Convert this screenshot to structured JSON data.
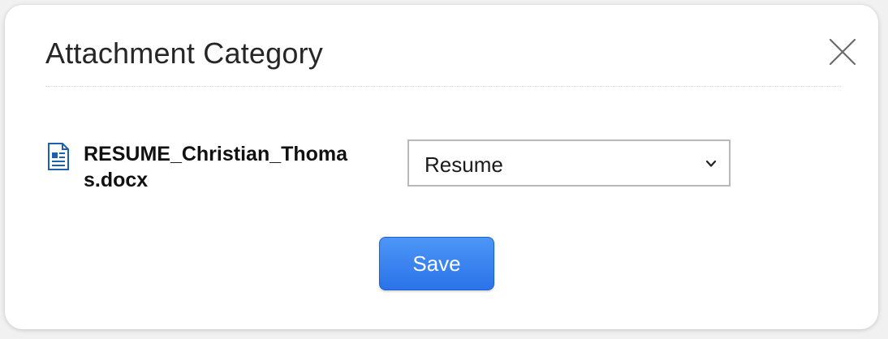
{
  "dialog": {
    "title": "Attachment Category",
    "close_icon": "close-icon"
  },
  "attachment": {
    "file_icon": "document-icon",
    "file_name": "RESUME_Christian_Thomas.docx"
  },
  "category": {
    "selected": "Resume",
    "dropdown_icon": "chevron-down-icon"
  },
  "actions": {
    "save_label": "Save"
  },
  "colors": {
    "accent": "#2f7bec",
    "file_icon": "#1f5fb0",
    "title_text": "#262626"
  }
}
